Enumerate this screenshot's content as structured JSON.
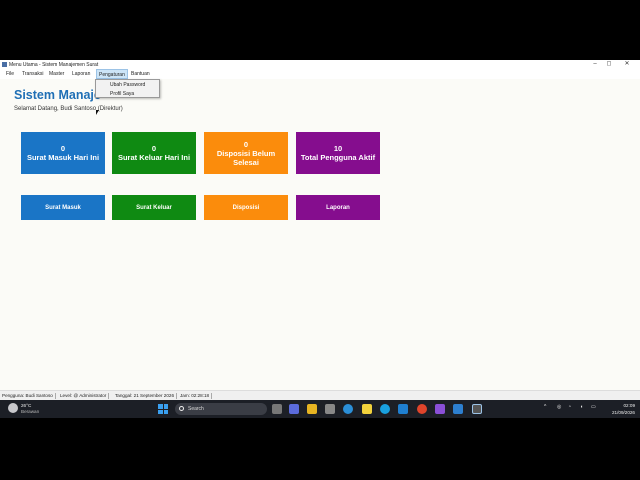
{
  "window": {
    "title": "Menu Utama - Sistem Manajemen Surat",
    "controls": {
      "minimize": "–",
      "maximize": "◻",
      "close": "✕"
    }
  },
  "menubar": {
    "items": [
      {
        "label": "File"
      },
      {
        "label": "Transaksi"
      },
      {
        "label": "Master"
      },
      {
        "label": "Laporan"
      },
      {
        "label": "Pengaturan"
      },
      {
        "label": "Bantuan"
      }
    ],
    "active": "Pengaturan"
  },
  "dropdown": {
    "items": [
      {
        "label": "Ubah Password"
      },
      {
        "label": "Profil Saya"
      }
    ]
  },
  "main": {
    "heading": "Sistem Manaje",
    "welcome": "Selamat Datang, Budi Santoso (Direktur)",
    "cards": [
      {
        "value": "0",
        "label": "Surat Masuk Hari Ini",
        "color": "#1a75c6"
      },
      {
        "value": "0",
        "label": "Surat Keluar Hari Ini",
        "color": "#0f8a12"
      },
      {
        "value": "0",
        "label": "Disposisi Belum Selesai",
        "color": "#fb8c0c"
      },
      {
        "value": "10",
        "label": "Total Pengguna Aktif",
        "color": "#850d8e"
      }
    ],
    "buttons": [
      {
        "label": "Surat Masuk",
        "color": "#1a75c6"
      },
      {
        "label": "Surat Keluar",
        "color": "#0f8a12"
      },
      {
        "label": "Disposisi",
        "color": "#fb8c0c"
      },
      {
        "label": "Laporan",
        "color": "#850d8e"
      }
    ]
  },
  "statusbar": {
    "user": "Pengguna: Budi Santoso",
    "level": "Level: @ Administrator",
    "date": "Tanggal: 21 September 2026",
    "time": "Jam: 02:28:18"
  },
  "taskbar": {
    "weather": {
      "temp": "26°C",
      "desc": "Berawan"
    },
    "search_label": "Search",
    "clock": {
      "time": "02:09",
      "date": "21/09/2026"
    }
  }
}
